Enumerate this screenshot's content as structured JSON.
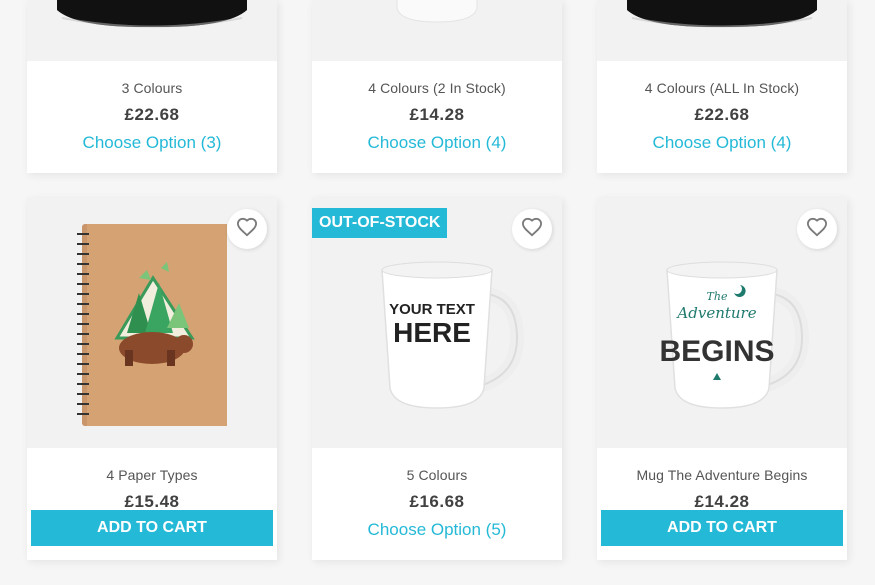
{
  "colors": {
    "accent": "#24b9d7",
    "page_bg": "#f6f6f6"
  },
  "products_top": [
    {
      "name": "3 Colours",
      "price": "£22.68",
      "action": "Choose Option (3)"
    },
    {
      "name": "4 Colours (2 In Stock)",
      "price": "£14.28",
      "action": "Choose Option (4)"
    },
    {
      "name": "4 Colours (ALL In Stock)",
      "price": "£22.68",
      "action": "Choose Option (4)"
    }
  ],
  "products_bottom": [
    {
      "name": "4 Paper Types",
      "price": "£15.48",
      "action": "ADD TO CART",
      "icon": "heart-outline-icon"
    },
    {
      "name": "5 Colours",
      "price": "£16.68",
      "action": "Choose Option (5)",
      "badge": "OUT-OF-STOCK",
      "mug_text_1": "YOUR TEXT",
      "mug_text_2": "HERE",
      "icon": "heart-outline-icon"
    },
    {
      "name": "Mug The Adventure Begins",
      "price": "£14.28",
      "action": "ADD TO CART",
      "mug_text_1": "The",
      "mug_text_2": "Adventure",
      "mug_text_3": "BEGINS",
      "icon": "heart-outline-icon"
    }
  ]
}
